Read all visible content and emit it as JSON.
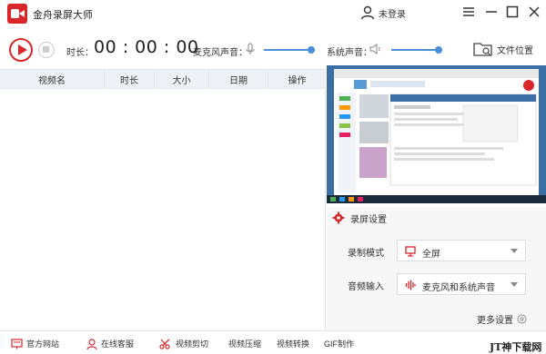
{
  "window": {
    "title": "金舟录屏大师",
    "login_label": "未登录"
  },
  "toolbar": {
    "duration_label": "时长：",
    "duration_value": "00 : 00 : 00",
    "mic_label": "麦克风声音：",
    "sys_label": "系统声音：",
    "mic_volume": 1.0,
    "sys_volume": 1.0,
    "folder_label": "文件位置"
  },
  "table": {
    "columns": [
      "视频名",
      "时长",
      "大小",
      "日期",
      "操作"
    ]
  },
  "settings": {
    "title": "录屏设置",
    "mode_label": "录制模式",
    "mode_value": "全屏",
    "audio_label": "音频输入",
    "audio_value": "麦克风和系统声音",
    "more_label": "更多设置"
  },
  "statusbar": {
    "items": [
      "官方网站",
      "在线客服",
      "视频剪切",
      "视频压缩",
      "视频转换",
      "GIF制作"
    ],
    "watermark": "JT神下载网"
  },
  "colors": {
    "accent": "#d9262b",
    "slider": "#4a90d9",
    "header_bg": "#eef1f5"
  }
}
